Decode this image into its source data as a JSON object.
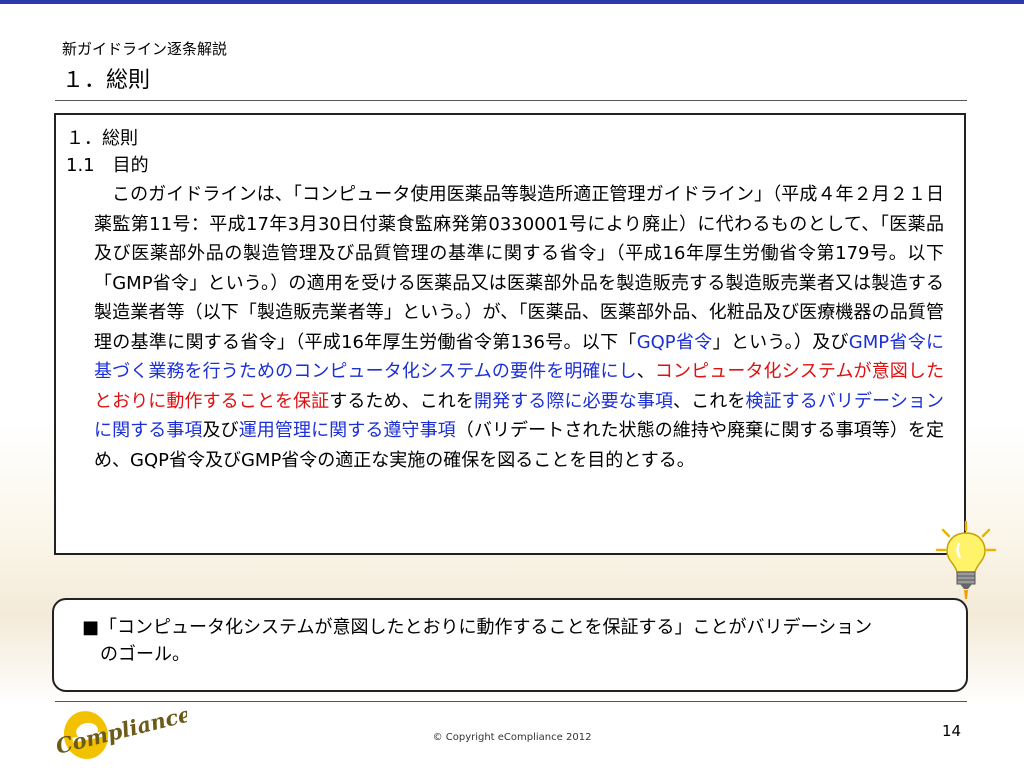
{
  "header": {
    "pre_title": "新ガイドライン逐条解説",
    "title": "１．総則"
  },
  "main": {
    "heading1": "１．総則",
    "heading2": "1.1　目的",
    "body": [
      {
        "text": "このガイドラインは、「コンピュータ使用医薬品等製造所適正管理ガイドライン」（平成４年２月２１日薬監第11号：平成17年3月30日付薬食監麻発第0330001号により廃止）に代わるものとして、「医薬品及び医薬部外品の製造管理及び品質管理の基準に関する省令」（平成16年厚生労働省令第179号。以下「GMP省令」という。）の適用を受ける医薬品又は医薬部外品を製造販売する製造販売業者又は製造する製造業者等（以下「製造販売業者等」という。）が、「医薬品、医薬部外品、化粧品及び医療機器の品質管理の基準に関する省令」（平成16年厚生労働省令第136号。以下「",
        "style": ""
      },
      {
        "text": "GQP省令",
        "style": "blue"
      },
      {
        "text": "」という。）及び",
        "style": ""
      },
      {
        "text": "GMP省令に基づく業務を行うためのコンピュータ化システムの要件を明確にし",
        "style": "blue"
      },
      {
        "text": "、",
        "style": ""
      },
      {
        "text": "コンピュータ化システムが意図したとおりに動作することを保証",
        "style": "red"
      },
      {
        "text": "するため、これを",
        "style": ""
      },
      {
        "text": "開発する際に必要な事項",
        "style": "blue"
      },
      {
        "text": "、これを",
        "style": ""
      },
      {
        "text": "検証するバリデーションに関する事項",
        "style": "blue"
      },
      {
        "text": "及び",
        "style": ""
      },
      {
        "text": "運用管理に関する遵守事項",
        "style": "blue"
      },
      {
        "text": "（バリデートされた状態の維持や廃棄に関する事項等）を定め、GQP省令及びGMP省令の適正な実施の確保を図ることを目的とする。",
        "style": ""
      }
    ]
  },
  "goal": {
    "line1": "■「コンピュータ化システムが意図したとおりに動作することを保証する」ことがバリデーション",
    "line2": "のゴール。"
  },
  "footer": {
    "logo_text": "Compliance",
    "copyright": "© Copyright eCompliance 2012",
    "page_number": "14"
  },
  "colors": {
    "accent_bar": "#2a3aa8",
    "highlight_blue": "#1b2fd6",
    "highlight_red": "#e01010",
    "logo_yellow": "#f2c200",
    "logo_text": "#6b5a18"
  },
  "icons": [
    "lightbulb-icon",
    "ecompliance-logo"
  ]
}
